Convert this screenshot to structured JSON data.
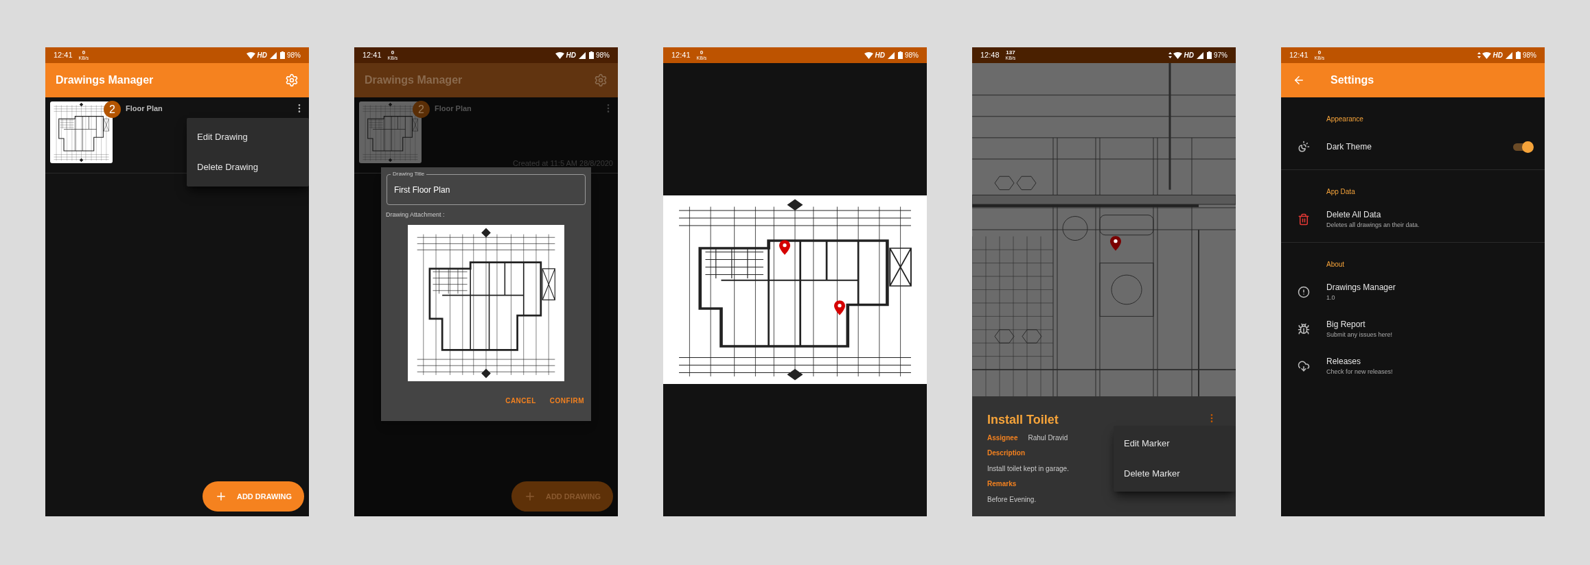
{
  "status_bars": [
    {
      "time": "12:41",
      "speed": "0",
      "speed_unit": "KB/s",
      "network": "HD",
      "battery": "98%",
      "data_activity": false
    },
    {
      "time": "12:41",
      "speed": "0",
      "speed_unit": "KB/s",
      "network": "HD",
      "battery": "98%",
      "data_activity": false
    },
    {
      "time": "12:41",
      "speed": "0",
      "speed_unit": "KB/s",
      "network": "HD",
      "battery": "98%",
      "data_activity": false
    },
    {
      "time": "12:48",
      "speed": "137",
      "speed_unit": "KB/s",
      "network": "HD",
      "battery": "97%",
      "data_activity": true
    },
    {
      "time": "12:41",
      "speed": "0",
      "speed_unit": "KB/s",
      "network": "HD",
      "battery": "98%",
      "data_activity": true
    }
  ],
  "drawings_list": {
    "title": "Drawings Manager",
    "items": [
      {
        "title": "Floor Plan",
        "badge": "2"
      }
    ],
    "menu": [
      "Edit Drawing",
      "Delete Drawing"
    ],
    "fab": "ADD DRAWING"
  },
  "edit_drawing": {
    "title": "Drawings Manager",
    "items": [
      {
        "title": "Floor Plan",
        "badge": "2",
        "created": "Created at 11:5 AM 28/8/2020"
      }
    ],
    "fab": "ADD DRAWING",
    "dialog": {
      "field_label": "Drawing Title",
      "field_value": "First Floor Plan",
      "attachment_label": "Drawing Attachment :",
      "buttons": [
        "CANCEL",
        "CONFIRM"
      ]
    }
  },
  "marker_detail": {
    "title": "Install Toilet",
    "fields": [
      {
        "kind": "inline",
        "label": "Assignee",
        "value": "Rahul Dravid"
      },
      {
        "kind": "stacked",
        "label": "Description",
        "value": "Install toilet kept in garage."
      },
      {
        "kind": "stacked",
        "label": "Remarks",
        "value": "Before Evening."
      }
    ],
    "menu": [
      "Edit Marker",
      "Delete Marker"
    ]
  },
  "settings": {
    "title": "Settings",
    "sections": [
      {
        "header": "Appearance",
        "items": [
          {
            "kind": "switch",
            "title": "Dark Theme",
            "on": true
          }
        ]
      },
      {
        "header": "App Data",
        "items": [
          {
            "kind": "danger",
            "title": "Delete All Data",
            "subtitle": "Deletes all drawings an their data."
          }
        ]
      },
      {
        "header": "About",
        "items": [
          {
            "kind": "info",
            "title": "Drawings Manager",
            "subtitle": "1.0"
          },
          {
            "kind": "info",
            "title": "Big Report",
            "subtitle": "Submit any issues here!"
          },
          {
            "kind": "info",
            "title": "Releases",
            "subtitle": "Check for new releases!"
          }
        ]
      }
    ]
  }
}
